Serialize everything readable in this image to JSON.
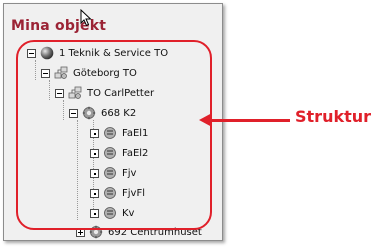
{
  "panel": {
    "title": "Mina objekt"
  },
  "tree": {
    "nodes": [
      {
        "label": "1 Teknik & Service TO",
        "icon": "globe-icon",
        "toggle": "minus"
      },
      {
        "label": "Göteborg TO",
        "icon": "network-icon",
        "toggle": "minus"
      },
      {
        "label": "TO CarlPetter",
        "icon": "network-icon",
        "toggle": "minus"
      },
      {
        "label": "668 K2",
        "icon": "gear-icon",
        "toggle": "minus"
      },
      {
        "label": "FaEl1",
        "icon": "component-icon",
        "toggle": "dot"
      },
      {
        "label": "FaEl2",
        "icon": "component-icon",
        "toggle": "dot"
      },
      {
        "label": "Fjv",
        "icon": "component-icon",
        "toggle": "dot"
      },
      {
        "label": "FjvFl",
        "icon": "component-icon",
        "toggle": "dot"
      },
      {
        "label": "Kv",
        "icon": "component-icon",
        "toggle": "dot"
      },
      {
        "label": "692 Centrumhuset",
        "icon": "gear-icon",
        "toggle": "plus"
      }
    ]
  },
  "annotation": {
    "callout": "Struktur",
    "color": "#e0202a"
  },
  "colors": {
    "title": "#9b2335",
    "panel_bg": "#f0f0f0"
  }
}
